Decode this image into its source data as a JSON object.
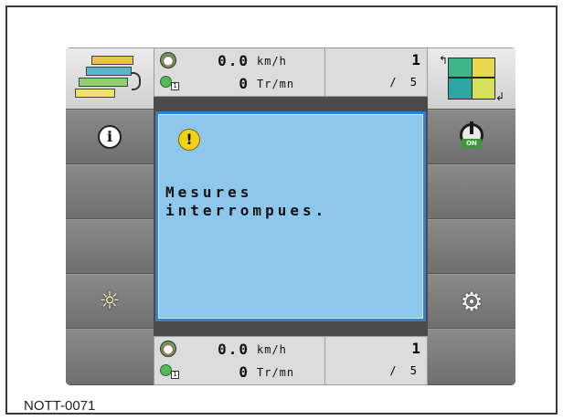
{
  "status_top": {
    "speed_value": "0.0",
    "speed_unit": "km/h",
    "rpm_value": "0",
    "rpm_unit": "Tr/mn",
    "page_current": "1",
    "page_total": "/ 5"
  },
  "status_bottom": {
    "speed_value": "0.0",
    "speed_unit": "km/h",
    "rpm_value": "0",
    "rpm_unit": "Tr/mn",
    "page_current": "1",
    "page_total": "/ 5"
  },
  "dialog": {
    "icon": "warning-icon",
    "icon_glyph": "!",
    "message": "Mesures\ninterrompues."
  },
  "left_buttons": [
    {
      "icon": "seeder-fields-icon"
    },
    {
      "icon": "info-icon",
      "glyph": "i"
    },
    {
      "icon": "empty"
    },
    {
      "icon": "empty"
    },
    {
      "icon": "brightness-icon"
    },
    {
      "icon": "empty"
    }
  ],
  "right_buttons": [
    {
      "icon": "field-map-icon"
    },
    {
      "icon": "power-on-icon",
      "tag": "ON"
    },
    {
      "icon": "empty"
    },
    {
      "icon": "empty"
    },
    {
      "icon": "settings-gear-icon"
    },
    {
      "icon": "empty"
    }
  ],
  "caption": "NOTT-0071",
  "colors": {
    "dialog_bg": "#8ec7ec",
    "dialog_border": "#3a7fc6",
    "warning": "#f5d21a",
    "button_gray": "#7d7d7d",
    "status_bg": "#dcdcdc"
  }
}
